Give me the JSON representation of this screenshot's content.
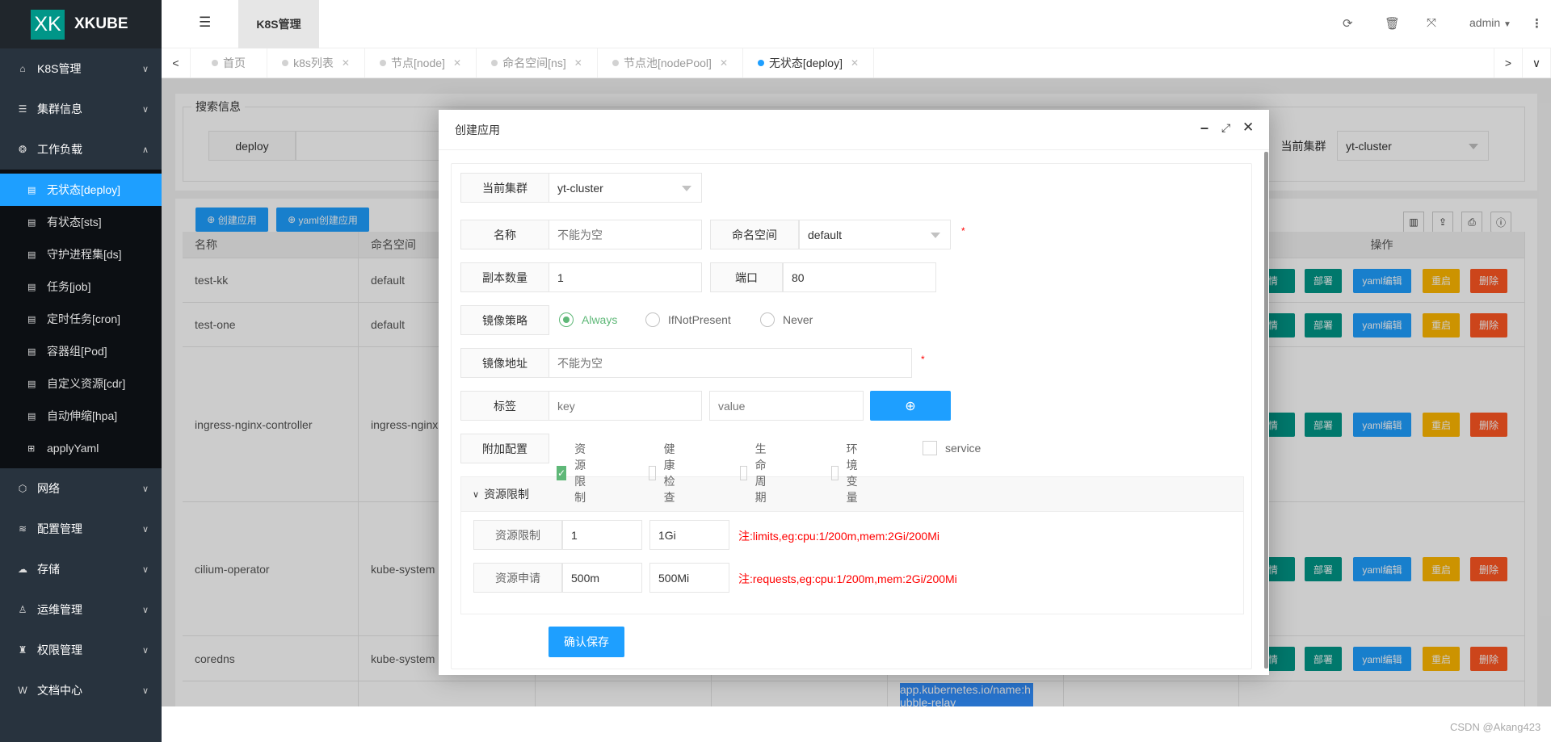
{
  "logo": {
    "mark": "XK",
    "name": "XKUBE"
  },
  "sidebar": {
    "items": [
      {
        "label": "K8S管理",
        "icon": "home-icon",
        "glyph": "⌂"
      },
      {
        "label": "集群信息",
        "icon": "server-icon",
        "glyph": "☰"
      },
      {
        "label": "工作负载",
        "icon": "cube-icon",
        "glyph": "❂"
      }
    ],
    "sub_items": [
      {
        "label": "无状态[deploy]",
        "active": true
      },
      {
        "label": "有状态[sts]"
      },
      {
        "label": "守护进程集[ds]"
      },
      {
        "label": "任务[job]"
      },
      {
        "label": "定时任务[cron]"
      },
      {
        "label": "容器组[Pod]"
      },
      {
        "label": "自定义资源[cdr]"
      },
      {
        "label": "自动伸缩[hpa]"
      },
      {
        "label": "applyYaml",
        "glyph": "⊞"
      }
    ],
    "items2": [
      {
        "label": "网络",
        "icon": "network-icon",
        "glyph": "⬡"
      },
      {
        "label": "配置管理",
        "icon": "database-icon",
        "glyph": "≋"
      },
      {
        "label": "存储",
        "icon": "cloud-icon",
        "glyph": "☁"
      },
      {
        "label": "运维管理",
        "icon": "linux-icon",
        "glyph": "♙"
      },
      {
        "label": "权限管理",
        "icon": "lock-icon",
        "glyph": "♜"
      },
      {
        "label": "文档中心",
        "icon": "wiki-icon",
        "glyph": "W"
      }
    ]
  },
  "header": {
    "module_tab": "K8S管理",
    "user": "admin"
  },
  "tabs": [
    "首页",
    "k8s列表",
    "节点[node]",
    "命名空间[ns]",
    "节点池[nodePool]",
    "无状态[deploy]"
  ],
  "search": {
    "legend": "搜索信息",
    "label": "deploy",
    "cluster_label": "当前集群",
    "cluster_value": "yt-cluster"
  },
  "toolbar": {
    "create": "创建应用",
    "yaml_create": "yaml创建应用"
  },
  "table": {
    "headers": [
      "名称",
      "命名空间",
      "",
      "",
      "",
      "",
      "操作"
    ],
    "rows": [
      {
        "name": "test-kk",
        "ns": "default"
      },
      {
        "name": "test-one",
        "ns": "default"
      },
      {
        "name": "ingress-nginx-controller",
        "ns": "ingress-nginx"
      },
      {
        "name": "cilium-operator",
        "ns": "kube-system"
      },
      {
        "name": "coredns",
        "ns": "kube-system"
      },
      {
        "name": "",
        "ns": "",
        "label": "app.kubernetes.io/name:hubble-relay"
      }
    ],
    "actions": [
      "详情",
      "部署",
      "yaml编辑",
      "重启",
      "删除"
    ]
  },
  "colors": {
    "accent": "#1e9fff",
    "green": "#5fb878",
    "teal": "#009688",
    "blue": "#1e9fff",
    "orange": "#ffb800",
    "red": "#ff5722"
  },
  "dialog": {
    "title": "创建应用",
    "cluster": {
      "label": "当前集群",
      "value": "yt-cluster"
    },
    "name": {
      "label": "名称",
      "placeholder": "不能为空"
    },
    "namespace": {
      "label": "命名空间",
      "value": "default"
    },
    "replicas": {
      "label": "副本数量",
      "value": "1"
    },
    "port": {
      "label": "端口",
      "value": "80"
    },
    "pull_policy": {
      "label": "镜像策略",
      "options": [
        "Always",
        "IfNotPresent",
        "Never"
      ],
      "selected": "Always"
    },
    "image": {
      "label": "镜像地址",
      "placeholder": "不能为空"
    },
    "tags": {
      "label": "标签",
      "key_placeholder": "key",
      "value_placeholder": "value"
    },
    "extra": {
      "label": "附加配置",
      "options": [
        {
          "label": "资源限制",
          "checked": true
        },
        {
          "label": "健康检查",
          "checked": false
        },
        {
          "label": "生命周期",
          "checked": false
        },
        {
          "label": "环境变量",
          "checked": false
        },
        {
          "label": "service",
          "checked": false
        }
      ]
    },
    "resources": {
      "title": "资源限制",
      "limit": {
        "label": "资源限制",
        "cpu": "1",
        "mem": "1Gi",
        "note": "注:limits,eg:cpu:1/200m,mem:2Gi/200Mi"
      },
      "request": {
        "label": "资源申请",
        "cpu": "500m",
        "mem": "500Mi",
        "note": "注:requests,eg:cpu:1/200m,mem:2Gi/200Mi"
      }
    },
    "save": "确认保存"
  },
  "watermark": "CSDN @Akang423"
}
